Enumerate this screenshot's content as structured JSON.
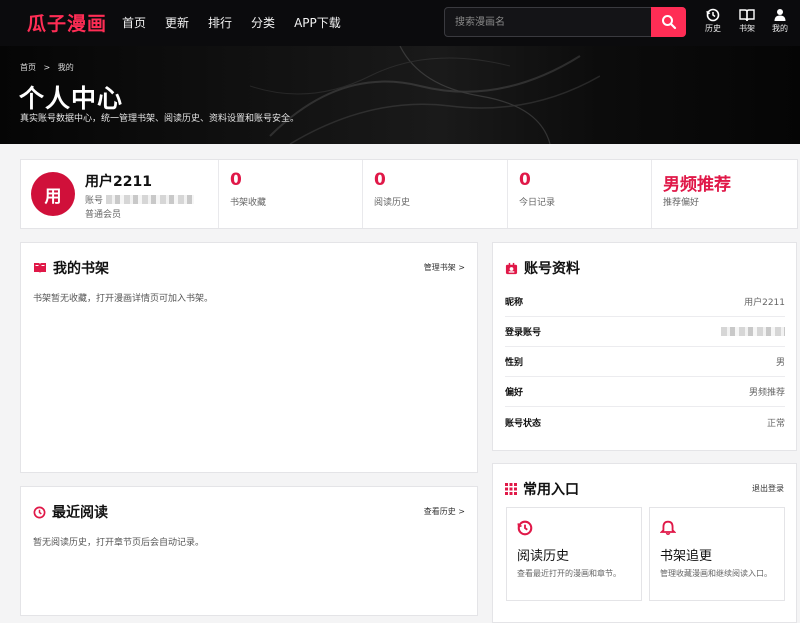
{
  "app": {
    "logo": "瓜子漫画"
  },
  "nav": {
    "items": [
      "首页",
      "更新",
      "排行",
      "分类",
      "APP下载"
    ]
  },
  "search": {
    "placeholder": "搜索漫画名"
  },
  "top_icons": [
    {
      "icon": "history-icon",
      "label": "历史"
    },
    {
      "icon": "bookshelf-icon",
      "label": "书架"
    },
    {
      "icon": "user-icon",
      "label": "我的"
    }
  ],
  "hero": {
    "breadcrumb_home": "首页",
    "breadcrumb_sep": ">",
    "breadcrumb_current": "我的",
    "title": "个人中心",
    "subtitle": "真实账号数据中心，统一管理书架、阅读历史、资料设置和账号安全。"
  },
  "profile": {
    "avatar_char": "用",
    "username": "用户2211",
    "account_label": "账号",
    "level": "普通会员"
  },
  "stats": [
    {
      "value": "0",
      "label": "书架收藏"
    },
    {
      "value": "0",
      "label": "阅读历史"
    },
    {
      "value": "0",
      "label": "今日记录"
    },
    {
      "value": "男频推荐",
      "label": "推荐偏好"
    }
  ],
  "bookshelf": {
    "title": "我的书架",
    "link": "管理书架 >",
    "empty": "书架暂无收藏，打开漫画详情页可加入书架。"
  },
  "recent": {
    "title": "最近阅读",
    "link": "查看历史 >",
    "empty": "暂无阅读历史，打开章节页后会自动记录。"
  },
  "account": {
    "title": "账号资料",
    "rows": [
      {
        "key": "昵称",
        "value": "用户2211"
      },
      {
        "key": "登录账号",
        "value": ""
      },
      {
        "key": "性别",
        "value": "男"
      },
      {
        "key": "偏好",
        "value": "男频推荐"
      },
      {
        "key": "账号状态",
        "value": "正常"
      }
    ]
  },
  "shortcuts": {
    "title": "常用入口",
    "link": "退出登录",
    "items": [
      {
        "name": "阅读历史",
        "desc": "查看最近打开的漫画和章节。"
      },
      {
        "name": "书架追更",
        "desc": "管理收藏漫画和继续阅读入口。"
      }
    ]
  },
  "colors": {
    "accent": "#e01848",
    "nav_bg": "#0b0b0d",
    "logo": "#ff2d55"
  }
}
